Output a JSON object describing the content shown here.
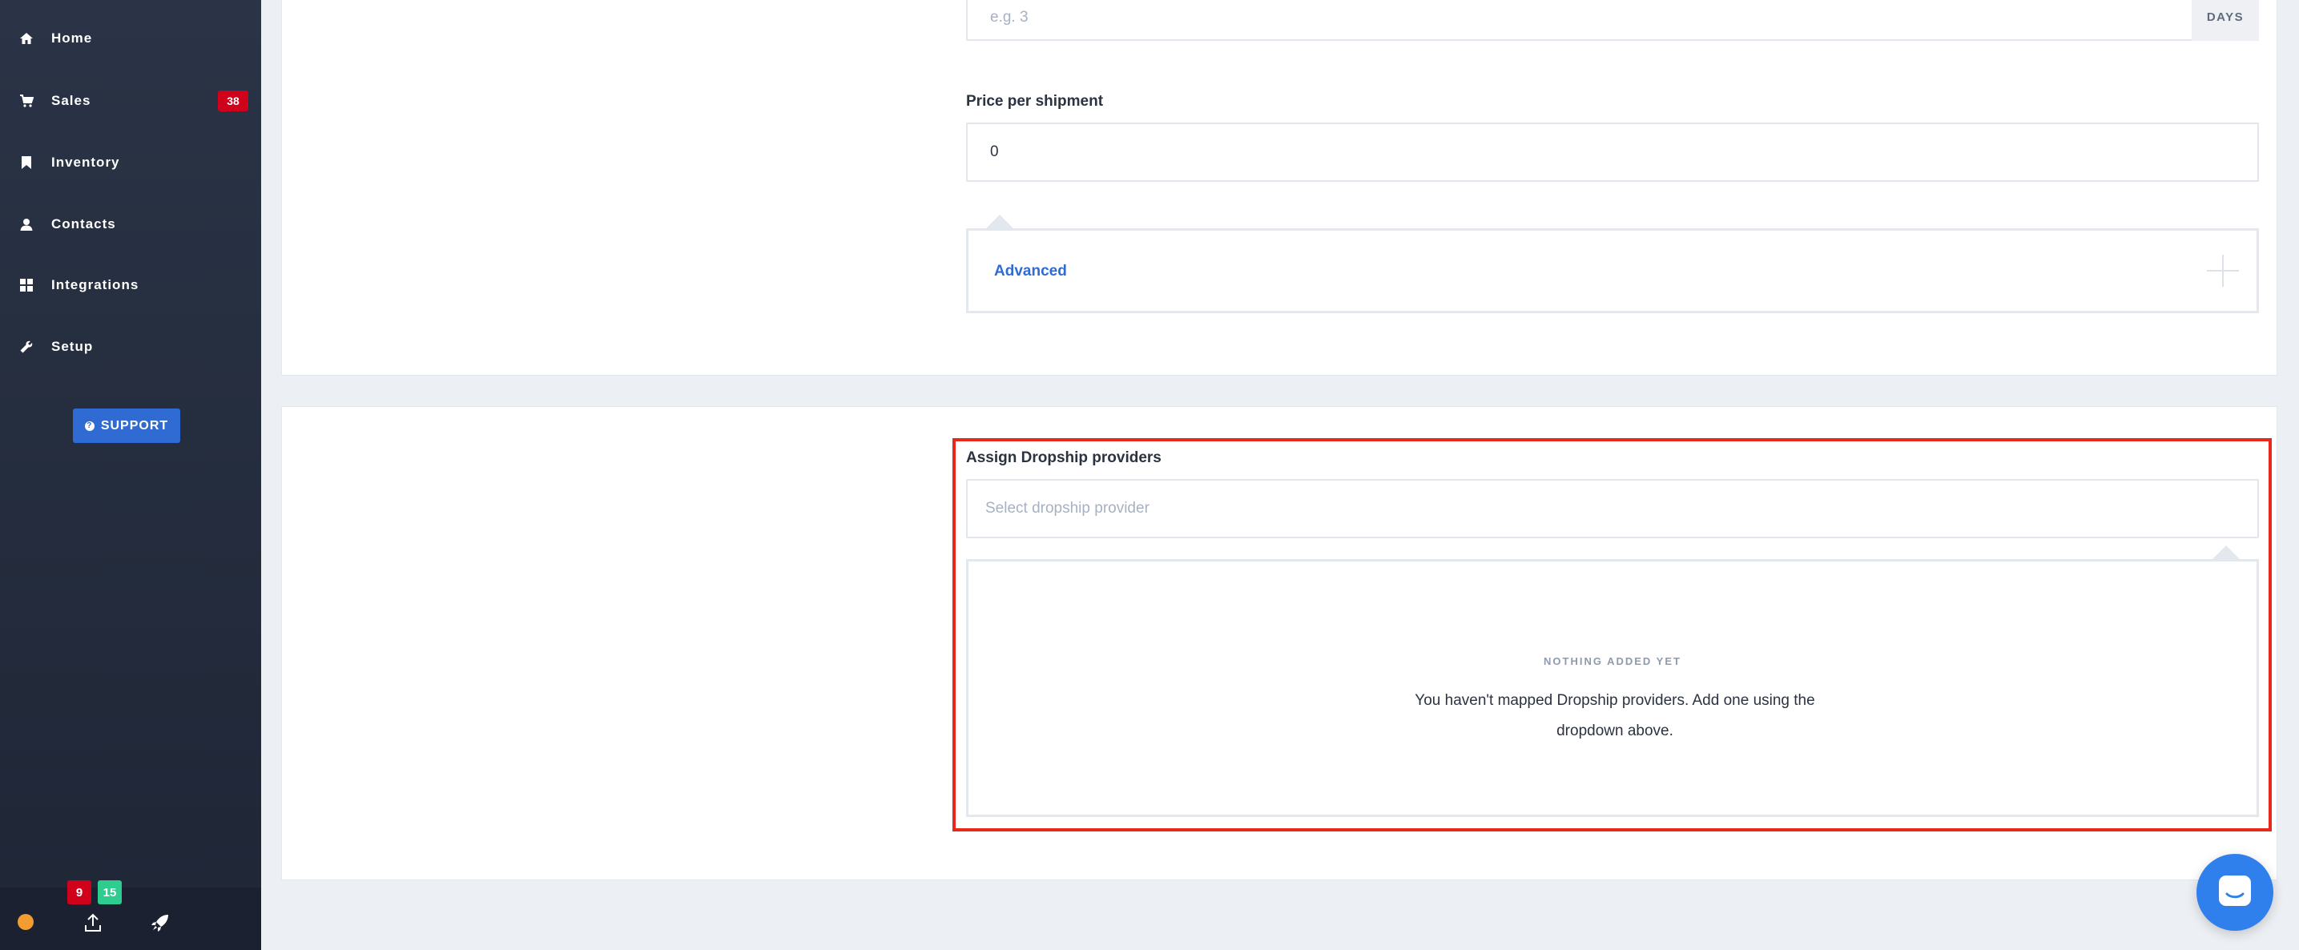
{
  "sidebar": {
    "items": [
      {
        "label": "Home",
        "icon": "home-icon"
      },
      {
        "label": "Sales",
        "icon": "cart-icon",
        "badge": "38"
      },
      {
        "label": "Inventory",
        "icon": "bookmark-icon"
      },
      {
        "label": "Contacts",
        "icon": "user-icon"
      },
      {
        "label": "Integrations",
        "icon": "grid-icon"
      },
      {
        "label": "Setup",
        "icon": "wrench-icon"
      }
    ],
    "support_label": "SUPPORT",
    "footer": {
      "status_color": "#f39c32",
      "badge_red": "9",
      "badge_green": "15"
    }
  },
  "lead_time": {
    "placeholder": "e.g. 3",
    "addon": "DAYS"
  },
  "price": {
    "label": "Price per shipment",
    "value": "0"
  },
  "advanced": {
    "label": "Advanced"
  },
  "dropship": {
    "label": "Assign Dropship providers",
    "placeholder": "Select dropship provider",
    "empty_title": "NOTHING ADDED YET",
    "empty_message": "You haven't mapped Dropship providers. Add one using the dropdown above."
  },
  "colors": {
    "accent": "#2f6bd2",
    "danger": "#d0021b",
    "success": "#2ecc8f",
    "highlight": "#e8271d"
  }
}
